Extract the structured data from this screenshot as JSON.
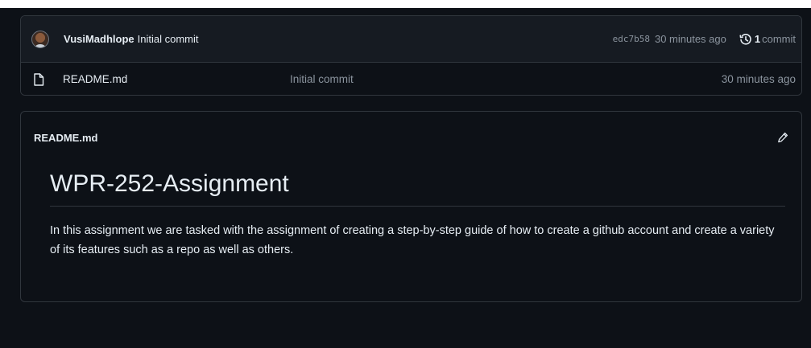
{
  "commit": {
    "author": "VusiMadhlope",
    "message": "Initial commit",
    "sha": "edc7b58",
    "time": "30 minutes ago",
    "count": "1",
    "count_label": "commit"
  },
  "files": [
    {
      "name": "README.md",
      "last_commit": "Initial commit",
      "time": "30 minutes ago",
      "icon": "file-icon"
    }
  ],
  "readme": {
    "filename": "README.md",
    "title": "WPR-252-Assignment",
    "body": "In this assignment we are tasked with the assignment of creating a step-by-step guide of how to create a github account and create a variety of its features such as a repo as well as others."
  },
  "colors": {
    "background": "#0d1117",
    "header_background": "#161b22",
    "border": "#30363d",
    "text": "#e6edf3",
    "muted": "#8b949e"
  }
}
